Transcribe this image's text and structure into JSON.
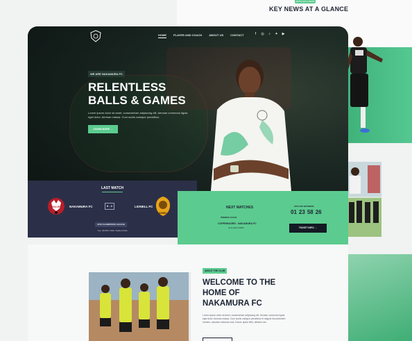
{
  "news": {
    "badge": "ARTICLES & NEWS",
    "heading": "KEY NEWS AT A GLANCE"
  },
  "nav": {
    "items": [
      "HOME",
      "PLAYER AND COACH",
      "ABOUT US",
      "CONTACT"
    ],
    "socials": [
      "facebook-icon",
      "instagram-icon",
      "tiktok-icon",
      "twitter-icon",
      "youtube-icon"
    ]
  },
  "hero": {
    "kicker": "WE ARE NAKAMURA FC",
    "title_line1": "RELENTLESS",
    "title_line2": "BALLS & GAMES",
    "description": "Lorem ipsum dolor sit amet, consectetuer adipiscing elit. Aenean commodo ligula eget dolor. Aenean massa. Cum sociis natoque penatibus.",
    "cta": "LEARN MORE →"
  },
  "last_match": {
    "title": "LAST MATCH",
    "home_team": "NAKAMURA FC",
    "away_team": "LIONELL FC",
    "score": "0 - 2",
    "league": "18TH CHAMPIONS LEAGUE",
    "date_venue": "Tue, 08.08.P 2020, Stallurd Park",
    "home_badge_text": "WOLVES",
    "away_badge_text": "LIONELL"
  },
  "next_matches": {
    "title": "NEXT MATCHES",
    "league": "PREMIER LEAGUE",
    "fixture": "COPENHAGEN - NAKAMURA FC",
    "date": "02.11.2022 3:00PM",
    "kickoff_label": "KICK-OFF BETWEEN:",
    "countdown": [
      "01",
      "23",
      "58",
      "26"
    ],
    "ticket_label": "TICKET INFO →"
  },
  "about": {
    "pill": "ABOUT THE CLUB",
    "title": "WELCOME TO THE HOME OF NAKAMURA FC",
    "text": "Lorem ipsum dolor sit amet, consectetuer adipiscing elit. Aenean commodo ligula eget dolor. Aenean massa. Cum sociis natoque penatibus et magnis dis parturient montes, nascetur ridiculus mus. Donec quam felis, ultricies nec."
  },
  "colors": {
    "accent": "#5ccb8f",
    "navy": "#2b3048",
    "dark": "#1b2433"
  }
}
